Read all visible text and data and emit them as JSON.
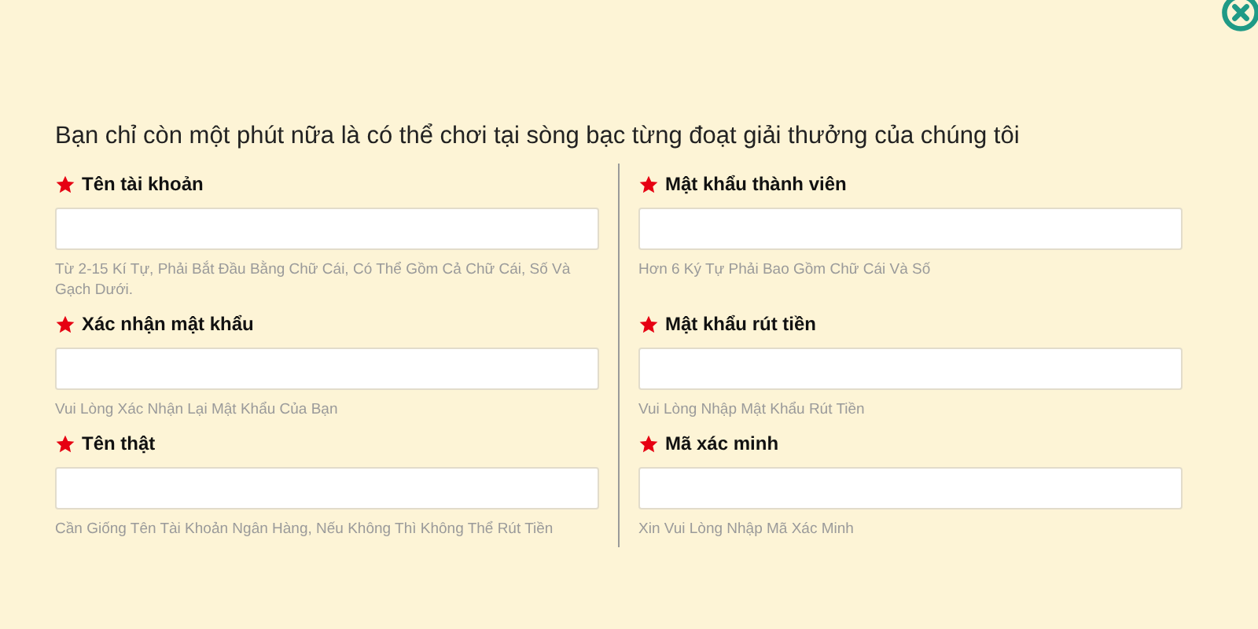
{
  "heading": "Bạn chỉ còn một phút nữa là có thể chơi tại sòng bạc từng đoạt giải thưởng của chúng tôi",
  "left_fields": [
    {
      "label": "Tên tài khoản",
      "required": true,
      "hint": "Từ 2-15 Kí Tự, Phải Bắt Đầu Bằng Chữ Cái, Có Thể Gồm Cả Chữ Cái, Số Và Gạch Dưới."
    },
    {
      "label": "Xác nhận mật khẩu",
      "required": true,
      "hint": "Vui Lòng Xác Nhận Lại Mật Khẩu Của Bạn"
    },
    {
      "label": "Tên thật",
      "required": true,
      "hint": "Cần Giống Tên Tài Khoản Ngân Hàng, Nếu Không Thì Không Thể Rút Tiền"
    }
  ],
  "right_fields": [
    {
      "label": "Mật khẩu thành viên",
      "required": true,
      "hint": "Hơn 6 Ký Tự Phải Bao Gồm Chữ Cái Và Số"
    },
    {
      "label": "Mật khẩu rút tiền",
      "required": true,
      "hint": "Vui Lòng Nhập Mật Khẩu Rút Tiền"
    },
    {
      "label": "Mã xác minh",
      "required": true,
      "hint": "Xin Vui Lòng Nhập Mã Xác Minh"
    }
  ]
}
